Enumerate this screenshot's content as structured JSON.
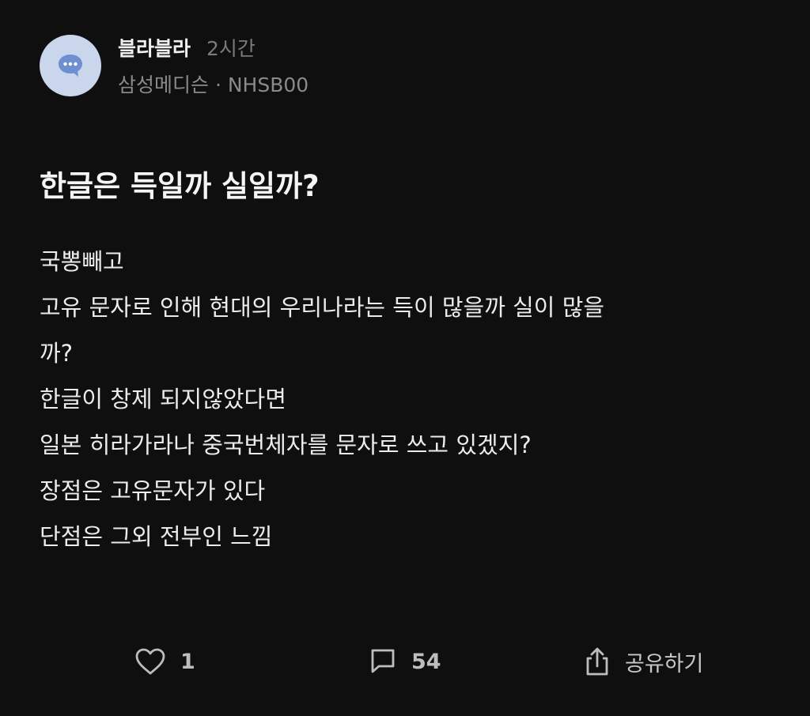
{
  "post": {
    "author": "블라블라",
    "time": "2시간",
    "company_tag": "삼성메디슨 · NHSB00",
    "title": "한글은 득일까 실일까?",
    "body_lines": [
      "국뽕빼고",
      "고유 문자로 인해 현대의 우리나라는 득이 많을까 실이 많을",
      "까?",
      "한글이 창제 되지않았다면",
      "일본 히라가라나 중국번체자를 문자로 쓰고 있겠지?",
      "장점은 고유문자가 있다",
      "단점은 그외 전부인 느낌"
    ]
  },
  "avatar": {
    "icon": "chat-bubble-icon",
    "color": "#c9d6ec",
    "accent": "#6f8fd0"
  },
  "actions": {
    "like": {
      "icon": "heart-icon",
      "count": "1"
    },
    "comment": {
      "icon": "comment-icon",
      "count": "54"
    },
    "share": {
      "icon": "share-icon",
      "label": "공유하기"
    }
  }
}
